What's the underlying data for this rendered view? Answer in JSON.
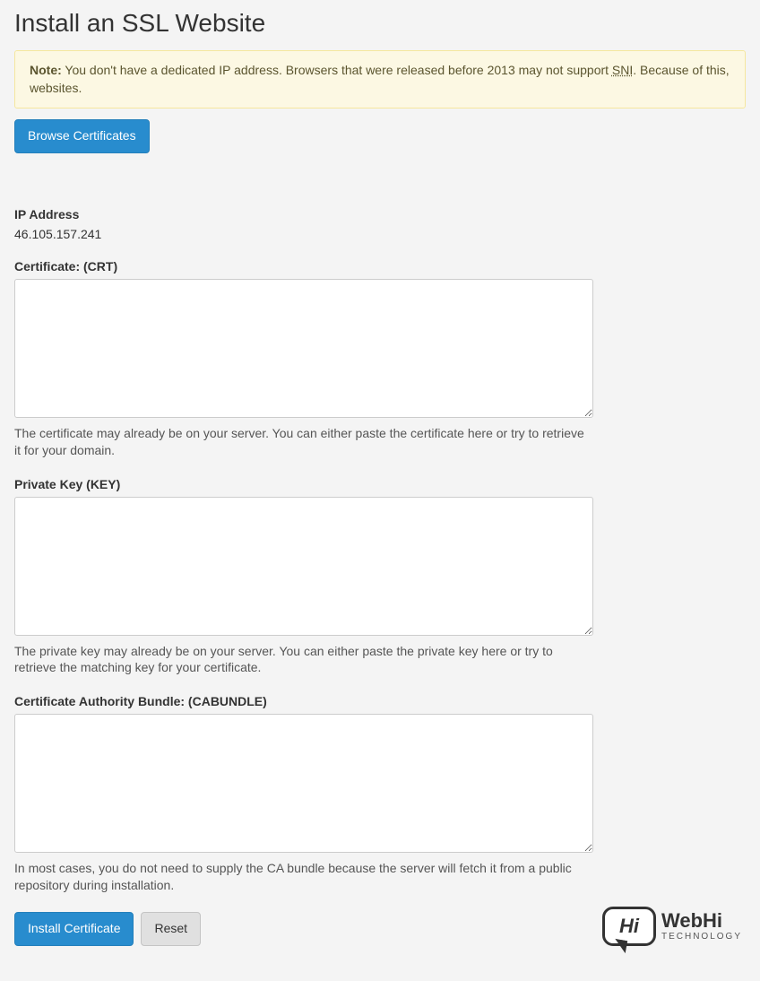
{
  "page": {
    "title": "Install an SSL Website"
  },
  "alert": {
    "label": "Note:",
    "text1": " You don't have a dedicated IP address. Browsers that were released before 2013 may not support ",
    "sni": "SNI",
    "text2": ". Because of this, websites."
  },
  "buttons": {
    "browse": "Browse Certificates",
    "install": "Install Certificate",
    "reset": "Reset"
  },
  "fields": {
    "ip": {
      "label": "IP Address",
      "value": "46.105.157.241"
    },
    "crt": {
      "label": "Certificate: (CRT)",
      "value": "",
      "help": "The certificate may already be on your server. You can either paste the certificate here or try to retrieve it for your domain."
    },
    "key": {
      "label": "Private Key (KEY)",
      "value": "",
      "help": "The private key may already be on your server. You can either paste the private key here or try to retrieve the matching key for your certificate."
    },
    "cabundle": {
      "label": "Certificate Authority Bundle: (CABUNDLE)",
      "value": "",
      "help": "In most cases, you do not need to supply the CA bundle because the server will fetch it from a public repository during installation."
    }
  },
  "logo": {
    "bubble": "Hi",
    "top": "WebHi",
    "bottom": "TECHNOLOGY"
  }
}
